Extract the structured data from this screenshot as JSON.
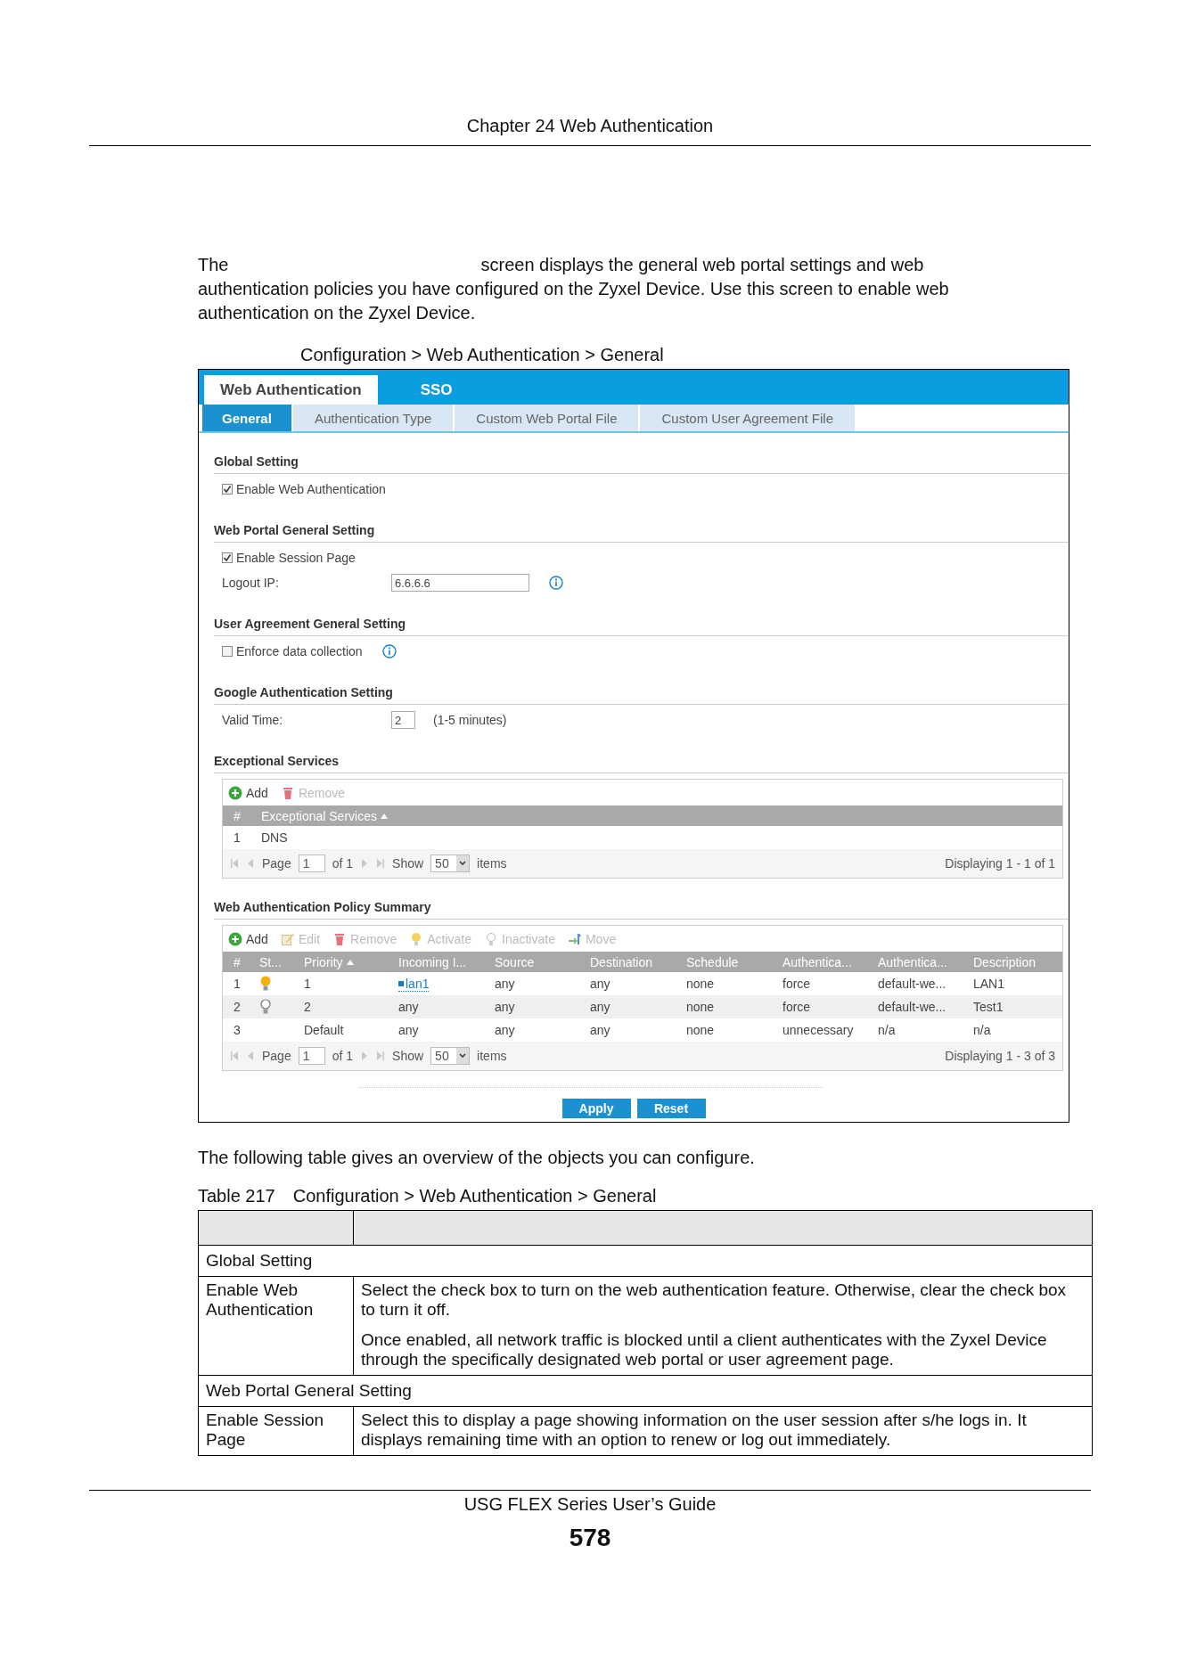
{
  "header": {
    "chapter": "Chapter 24 Web Authentication"
  },
  "intro": {
    "before": "The",
    "after": "screen displays the general web portal settings and web authentication policies you have configured on the Zyxel Device. Use this screen to enable web authentication on the Zyxel Device."
  },
  "figure_caption": "Configuration > Web Authentication > General",
  "screen": {
    "main_tabs": [
      {
        "label": "Web Authentication",
        "selected": true
      },
      {
        "label": "SSO",
        "selected": false
      }
    ],
    "sub_tabs": [
      {
        "label": "General",
        "selected": true
      },
      {
        "label": "Authentication Type",
        "selected": false
      },
      {
        "label": "Custom Web Portal File",
        "selected": false
      },
      {
        "label": "Custom User Agreement File",
        "selected": false
      }
    ],
    "sections": [
      {
        "title": "Global Setting",
        "kind": "form",
        "items": [
          {
            "kind": "checkbox",
            "label": "Enable Web Authentication",
            "checked": true
          }
        ]
      },
      {
        "title": "Web Portal General Setting",
        "kind": "form",
        "items": [
          {
            "kind": "checkbox",
            "label": "Enable Session Page",
            "checked": true
          },
          {
            "kind": "field",
            "label": "Logout IP:",
            "value": "6.6.6.6",
            "info": true
          }
        ]
      },
      {
        "title": "User Agreement General Setting",
        "kind": "form",
        "items": [
          {
            "kind": "checkbox",
            "label": "Enforce data collection",
            "checked": false,
            "info": true
          }
        ]
      },
      {
        "title": "Google Authentication Setting",
        "kind": "form",
        "items": [
          {
            "kind": "number",
            "label": "Valid Time:",
            "value": "2",
            "hint": "(1-5 minutes)"
          }
        ]
      },
      {
        "title": "Exceptional Services",
        "kind": "list_table",
        "toolbar": [
          {
            "kind": "add",
            "label": "Add",
            "disabled": false
          },
          {
            "kind": "remove",
            "label": "Remove",
            "disabled": true
          }
        ],
        "columns": [
          {
            "label": "#",
            "sorted": false
          },
          {
            "label": "Exceptional Services",
            "sorted": true
          }
        ],
        "rows": [
          {
            "cells": [
              "1",
              "DNS"
            ]
          }
        ],
        "pager": {
          "page_label": "Page",
          "page": "1",
          "of": "of 1",
          "show_label": "Show",
          "per_page": "50",
          "items_label": "items",
          "displaying": "Displaying 1 - 1 of 1"
        }
      },
      {
        "title": "Web Authentication Policy Summary",
        "kind": "policy_table",
        "toolbar": [
          {
            "kind": "add",
            "label": "Add",
            "disabled": false
          },
          {
            "kind": "edit",
            "label": "Edit",
            "disabled": true
          },
          {
            "kind": "remove",
            "label": "Remove",
            "disabled": true
          },
          {
            "kind": "activate",
            "label": "Activate",
            "disabled": true
          },
          {
            "kind": "inactivate",
            "label": "Inactivate",
            "disabled": true
          },
          {
            "kind": "move",
            "label": "Move",
            "disabled": true
          }
        ],
        "columns": [
          {
            "label": "#",
            "sorted": false
          },
          {
            "label": "St...",
            "sorted": false
          },
          {
            "label": "Priority",
            "sorted": true
          },
          {
            "label": "Incoming I...",
            "sorted": false
          },
          {
            "label": "Source",
            "sorted": false
          },
          {
            "label": "Destination",
            "sorted": false
          },
          {
            "label": "Schedule",
            "sorted": false
          },
          {
            "label": "Authentica...",
            "sorted": false
          },
          {
            "label": "Authentica...",
            "sorted": false
          },
          {
            "label": "Description",
            "sorted": false
          }
        ],
        "rows": [
          {
            "active": true,
            "incoming_link": true,
            "cells": [
              "1",
              "",
              "1",
              "lan1",
              "any",
              "any",
              "none",
              "force",
              "default-we...",
              "LAN1"
            ]
          },
          {
            "active": false,
            "incoming_link": false,
            "cells": [
              "2",
              "",
              "2",
              "any",
              "any",
              "any",
              "none",
              "force",
              "default-we...",
              "Test1"
            ]
          },
          {
            "incoming_link": false,
            "cells": [
              "3",
              "",
              "Default",
              "any",
              "any",
              "any",
              "none",
              "unnecessary",
              "n/a",
              "n/a"
            ]
          }
        ],
        "pager": {
          "page_label": "Page",
          "page": "1",
          "of": "of 1",
          "show_label": "Show",
          "per_page": "50",
          "items_label": "items",
          "displaying": "Displaying 1 - 3 of 3"
        }
      }
    ],
    "buttons": [
      "Apply",
      "Reset"
    ]
  },
  "after_text": "The following table gives an overview of the objects you can configure.",
  "table_caption": {
    "number": "Table 217",
    "title": "Configuration > Web Authentication > General"
  },
  "table": {
    "rows": [
      {
        "kind": "section",
        "label": "Global Setting"
      },
      {
        "kind": "entry",
        "label": "Enable Web Authentication",
        "paragraphs": [
          "Select the check box to turn on the web authentication feature. Otherwise, clear the check box to turn it off.",
          "Once enabled, all network traffic is blocked until a client authenticates with the Zyxel Device through the specifically designated web portal or user agreement page."
        ]
      },
      {
        "kind": "section",
        "label": "Web Portal General Setting"
      },
      {
        "kind": "entry",
        "label": "Enable Session Page",
        "paragraphs": [
          "Select this to display a page showing information on the user session after s/he logs in. It displays remaining time with an option to renew or log out immediately."
        ]
      }
    ]
  },
  "footer": {
    "guide": "USG FLEX Series User’s Guide",
    "page": "578"
  }
}
